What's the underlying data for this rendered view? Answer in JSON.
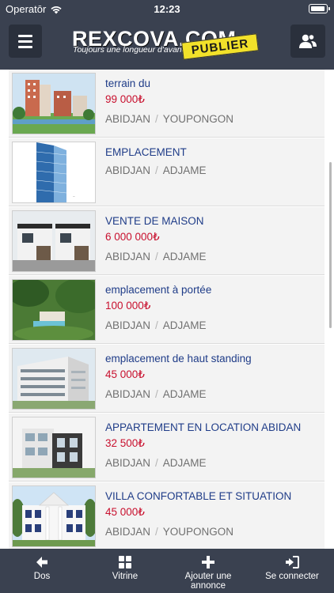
{
  "status_bar": {
    "carrier": "Operatōr",
    "time": "12:23"
  },
  "header": {
    "brand": "REXCOVA.COM",
    "tagline": "Toujours une longueur d'avance",
    "publish_label": "PUBLIER"
  },
  "listings": [
    {
      "title": "terrain du",
      "price": "99 000₺",
      "city": "ABIDJAN",
      "district": "YOUPONGON"
    },
    {
      "title": "EMPLACEMENT",
      "price": "",
      "city": "ABIDJAN",
      "district": "ADJAME"
    },
    {
      "title": "VENTE DE MAISON",
      "price": "6 000 000₺",
      "city": "ABIDJAN",
      "district": "ADJAME"
    },
    {
      "title": "emplacement à portée",
      "price": "100 000₺",
      "city": "ABIDJAN",
      "district": "ADJAME"
    },
    {
      "title": "emplacement de haut standing",
      "price": "45 000₺",
      "city": "ABIDJAN",
      "district": "ADJAME"
    },
    {
      "title": "APPARTEMENT EN LOCATION ABIDAN",
      "price": "32 500₺",
      "city": "ABIDJAN",
      "district": "ADJAME"
    },
    {
      "title": "VILLA CONFORTABLE ET SITUATION",
      "price": "45 000₺",
      "city": "ABIDJAN",
      "district": "YOUPONGON"
    }
  ],
  "location_separator": "/",
  "nav": {
    "back": "Dos",
    "showcase": "Vitrine",
    "add": "Ajouter une annonce",
    "login": "Se connecter"
  },
  "colors": {
    "header_bg": "#3a4150",
    "title": "#1f3c88",
    "price": "#c8102e",
    "publish": "#f2e12a"
  }
}
